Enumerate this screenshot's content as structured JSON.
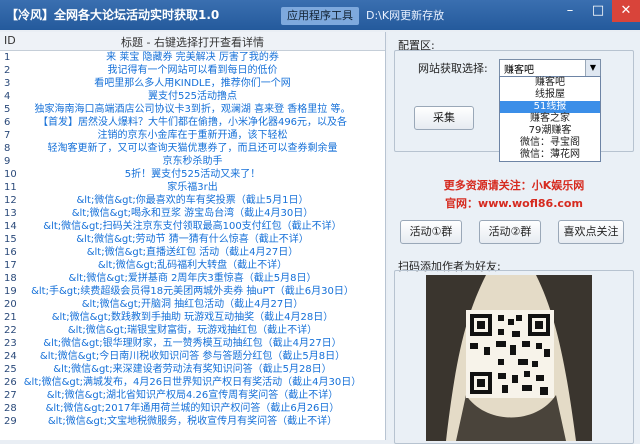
{
  "titlebar": {
    "title": "【冷风】全网各大论坛活动实时获取1.0",
    "tabs": [
      {
        "label": "应用程序工具",
        "active": true
      },
      {
        "label": "D:\\K网更新存放",
        "active": false
      }
    ]
  },
  "list": {
    "col_id": "ID",
    "col_title": "标题 - 右键选择打开查看详情",
    "rows": [
      {
        "id": "1",
        "text": "来  莱宝  隐藏券  完美解决  厉害了我的券"
      },
      {
        "id": "2",
        "text": "我记得有一个网站可以看到每日的低价"
      },
      {
        "id": "3",
        "text": "看吧里那么多人用KINDLE，推荐你们一个网"
      },
      {
        "id": "4",
        "text": "翼支付525活动撸点"
      },
      {
        "id": "5",
        "text": "独家海南海口高端酒店公司协议卡3到折，观澜湖  喜来登  香格里拉  等。"
      },
      {
        "id": "6",
        "text": "【首发】居然没人爆料？大牛们都在偷撸，小米净化器496元，以及各"
      },
      {
        "id": "7",
        "text": "注销的京东小金库在于重新开通，该下轻松"
      },
      {
        "id": "8",
        "text": "轻淘客更新了，又可以查询天猫优惠券了，而且还可以查券剩余量"
      },
      {
        "id": "9",
        "text": "京东秒杀助手"
      },
      {
        "id": "10",
        "text": "5折！翼支付525活动又来了！"
      },
      {
        "id": "11",
        "text": "家乐福3r出"
      },
      {
        "id": "12",
        "text": "&lt;微信&gt;你最喜欢的车有奖投票（截止5月1日）"
      },
      {
        "id": "13",
        "text": "&lt;微信&gt;喝永和豆浆  游宝岛台湾（截止4月30日）"
      },
      {
        "id": "14",
        "text": "&lt;微信&gt;扫码关注京东支付领取最高100支付红包（截止不详）"
      },
      {
        "id": "15",
        "text": "&lt;微信&gt;劳动节  猜一猜有什么惊喜（截止不详）"
      },
      {
        "id": "16",
        "text": "&lt;微信&gt;直播送红包  活动（截止4月27日）"
      },
      {
        "id": "17",
        "text": "&lt;微信&gt;乱码福利大转盘（截止不详）"
      },
      {
        "id": "18",
        "text": "&lt;微信&gt;爱拼基商  2周年庆3重惊喜（截止5月8日）"
      },
      {
        "id": "19",
        "text": "&lt;手&gt;续费超级会员得18元美团两城外卖券  抽uPT（截止6月30日）"
      },
      {
        "id": "20",
        "text": "&lt;微信&gt;开脑洞  抽红包活动（截止4月27日）"
      },
      {
        "id": "21",
        "text": "&lt;微信&gt;数践教到手抽助  玩游戏互动抽奖（截止4月28日）"
      },
      {
        "id": "22",
        "text": "&lt;微信&gt;瑞银宝财富街，玩游戏抽红包（截止不详）"
      },
      {
        "id": "23",
        "text": "&lt;微信&gt;银华理财家，五一赞秀模互动抽红包（截止4月27日）"
      },
      {
        "id": "24",
        "text": "&lt;微信&gt;今日南川税收知识问答  参与答题分红包（截止5月8日）"
      },
      {
        "id": "25",
        "text": "&lt;微信&gt;来深建设者劳动法有奖知识问答（截止5月28日）"
      },
      {
        "id": "26",
        "text": "&lt;微信&gt;满城发布，4月26日世界知识产权日有奖活动（截止4月30日）"
      },
      {
        "id": "27",
        "text": "&lt;微信&gt;湖北省知识产权局4.26宣传周有奖问答（截止不详）"
      },
      {
        "id": "28",
        "text": "&lt;微信&gt;2017年通用荷兰城的知识产权问答（截止6月26日）"
      },
      {
        "id": "29",
        "text": "&lt;微信&gt;文宝地税微服务，税收宣传月有奖问答（截止不详）"
      }
    ]
  },
  "config": {
    "section_label": "配置区:",
    "site_label": "网站获取选择:",
    "selected": "赚客吧",
    "options": [
      "赚客吧",
      "线报屋",
      "51线报",
      "赚客之家",
      "79潮赚客",
      "微信：寻宝阁",
      "微信：薄花网"
    ],
    "selected_option_index": 2,
    "collect_button": "采集"
  },
  "promo": {
    "line1": "更多资源请关注：小K娱乐网",
    "line2": "官网：www.wofl86.com"
  },
  "buttons": {
    "group1": "活动①群",
    "group2": "活动②群",
    "like": "喜欢点关注"
  },
  "qr": {
    "label": "扫码添加作者为好友:"
  }
}
